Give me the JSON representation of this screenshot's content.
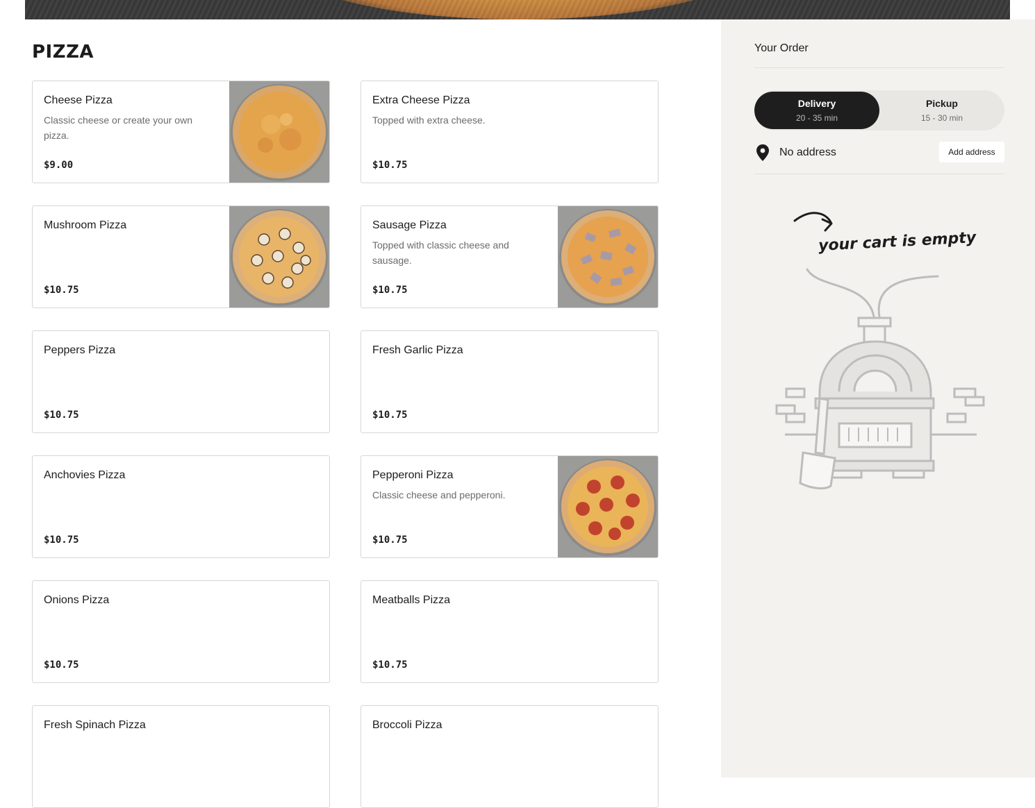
{
  "menu": {
    "section_title": "PIZZA",
    "items": [
      {
        "name": "Cheese Pizza",
        "description": "Classic cheese or create your own pizza.",
        "price": "$9.00"
      },
      {
        "name": "Extra Cheese Pizza",
        "description": "Topped with extra cheese.",
        "price": "$10.75"
      },
      {
        "name": "Mushroom Pizza",
        "description": "",
        "price": "$10.75"
      },
      {
        "name": "Sausage Pizza",
        "description": "Topped with classic cheese and sausage.",
        "price": "$10.75"
      },
      {
        "name": "Peppers Pizza",
        "description": "",
        "price": "$10.75"
      },
      {
        "name": "Fresh Garlic Pizza",
        "description": "",
        "price": "$10.75"
      },
      {
        "name": "Anchovies Pizza",
        "description": "",
        "price": "$10.75"
      },
      {
        "name": "Pepperoni Pizza",
        "description": "Classic cheese and pepperoni.",
        "price": "$10.75"
      },
      {
        "name": "Onions Pizza",
        "description": "",
        "price": "$10.75"
      },
      {
        "name": "Meatballs Pizza",
        "description": "",
        "price": "$10.75"
      },
      {
        "name": "Fresh Spinach Pizza",
        "description": "",
        "price": ""
      },
      {
        "name": "Broccoli Pizza",
        "description": "",
        "price": ""
      }
    ]
  },
  "order": {
    "title": "Your Order",
    "delivery": {
      "label": "Delivery",
      "time": "20 - 35 min"
    },
    "pickup": {
      "label": "Pickup",
      "time": "15 - 30 min"
    },
    "address": "No address",
    "add_address_label": "Add address",
    "empty_message": "your cart is empty"
  },
  "colors": {
    "accent_dark": "#1e1e1e",
    "sidebar_bg": "#f3f2ef"
  },
  "icons": {
    "location": "location-pin-icon",
    "empty_cart": "pizza-oven-illustration"
  }
}
